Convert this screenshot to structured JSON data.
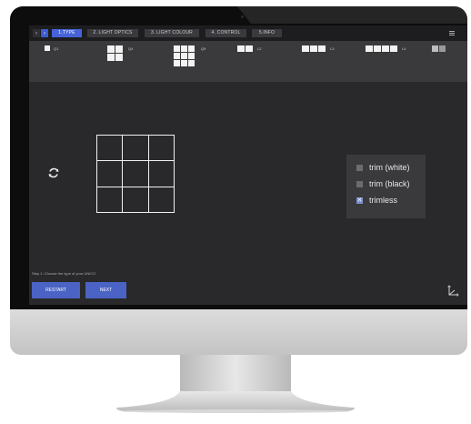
{
  "nav": {
    "prev_glyph": "‹",
    "next_glyph": "›",
    "tabs": [
      {
        "label": "1.TYPE",
        "active": true
      },
      {
        "label": "2. LIGHT OPTICS",
        "active": false
      },
      {
        "label": "3. LIGHT COLOUR",
        "active": false
      },
      {
        "label": "4. CONTROL",
        "active": false
      },
      {
        "label": "5.INFO",
        "active": false
      }
    ],
    "menu_icon": "hamburger-icon"
  },
  "type_options": [
    {
      "label": "Q1"
    },
    {
      "label": "Q4"
    },
    {
      "label": "Q9"
    },
    {
      "label": "L2"
    },
    {
      "label": "L3"
    },
    {
      "label": "L4"
    },
    {
      "label": ""
    }
  ],
  "main": {
    "refresh_icon": "refresh-icon",
    "preview_icon": "grid-3x3-preview"
  },
  "trim_dropdown": {
    "items": [
      {
        "label": "trim (white)",
        "checked": false
      },
      {
        "label": "trim (black)",
        "checked": false
      },
      {
        "label": "trimless",
        "checked": true,
        "mark": "✕"
      }
    ]
  },
  "footer": {
    "step_text": "Step 1: Choose the type of your UNICO",
    "restart_label": "RESTART",
    "next_label": "NEXT",
    "axis_icon": "axis-icon"
  },
  "colors": {
    "accent": "#4663d8",
    "screen_bg": "#29292b",
    "panel_bg": "#3a3a3d"
  }
}
